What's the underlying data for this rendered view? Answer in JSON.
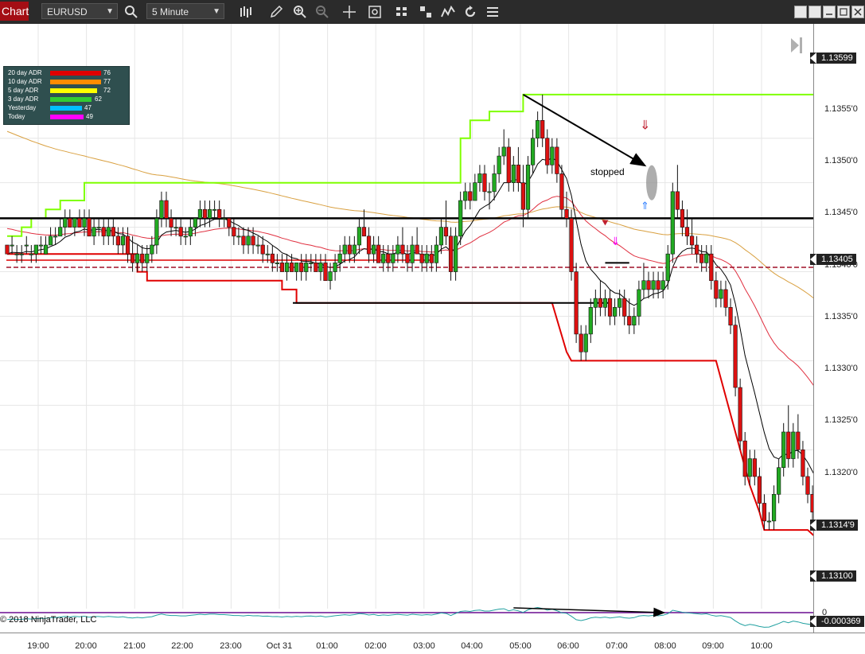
{
  "toolbar": {
    "chart_tab": "Chart",
    "instrument": "EURUSD",
    "interval": "5 Minute",
    "icons": [
      "search-icon",
      "bar-type-icon",
      "pencil-icon",
      "zoom-in-icon",
      "zoom-out-icon",
      "crosshair-icon",
      "data-box-icon",
      "properties-icon",
      "strategy-icon",
      "indicators-icon",
      "reload-icon",
      "menu-icon"
    ],
    "window_buttons": [
      "tile-1",
      "tile-2",
      "minimize",
      "restore",
      "close"
    ]
  },
  "legend": {
    "rows": [
      {
        "label": "20 day ADR",
        "color": "#e00000",
        "value": "76"
      },
      {
        "label": "10 day ADR",
        "color": "#ff8c00",
        "value": "77"
      },
      {
        "label": "5 day ADR",
        "color": "#ffff00",
        "value": "72"
      },
      {
        "label": "3 day ADR",
        "color": "#32cd32",
        "value": "62"
      },
      {
        "label": "Yesterday",
        "color": "#00bfff",
        "value": "47"
      },
      {
        "label": "Today",
        "color": "#ff00ff",
        "value": "49"
      }
    ]
  },
  "annotations": {
    "stopped": "stopped",
    "copyright": "© 2018 NinjaTrader, LLC"
  },
  "price_axis": {
    "labels": [
      "1.1355'0",
      "1.1350'0",
      "1.1345'0",
      "1.1340'0",
      "1.1335'0",
      "1.1330'0",
      "1.1325'0",
      "1.1320'0"
    ],
    "tags": {
      "high": "1.13599",
      "mid": "1.13405",
      "last": "1.1314'9",
      "low": "1.13100",
      "oscillator": "-0.000369"
    },
    "osc_zero": "0"
  },
  "time_axis": {
    "labels": [
      "19:00",
      "20:00",
      "21:00",
      "22:00",
      "23:00",
      "Oct 31",
      "01:00",
      "02:00",
      "03:00",
      "04:00",
      "05:00",
      "06:00",
      "07:00",
      "08:00",
      "09:00",
      "10:00"
    ]
  },
  "colors": {
    "up_candle": "#22aa22",
    "down_candle": "#dd1111",
    "upper_band": "#7fff00",
    "lower_band": "#e00000",
    "key_level": "#000000",
    "dashed_level": "#a01028",
    "ema_fast": "#000000",
    "ema_mid": "#e03040",
    "ema_slow": "#d9a040",
    "oscillator": "#20a0a0"
  },
  "chart_data": {
    "type": "candlestick",
    "instrument": "EURUSD",
    "interval": "5 Minute",
    "ylim": [
      1.1306,
      1.1364
    ],
    "key_levels": {
      "resistance": 1.1346,
      "dashed": 1.13405,
      "range_low": 1.13365
    },
    "x_ticks": [
      "19:00",
      "20:00",
      "21:00",
      "22:00",
      "23:00",
      "Oct 31",
      "01:00",
      "02:00",
      "03:00",
      "04:00",
      "05:00",
      "06:00",
      "07:00",
      "08:00",
      "09:00",
      "10:00"
    ],
    "upper_band": [
      [
        0,
        1.1344
      ],
      [
        3,
        1.1344
      ],
      [
        3,
        1.1345
      ],
      [
        5,
        1.1345
      ],
      [
        5,
        1.1346
      ],
      [
        8,
        1.1346
      ],
      [
        8,
        1.1347
      ],
      [
        11,
        1.1347
      ],
      [
        11,
        1.1348
      ],
      [
        16,
        1.1348
      ],
      [
        16,
        1.135
      ],
      [
        94,
        1.135
      ],
      [
        94,
        1.1355
      ],
      [
        96,
        1.1355
      ],
      [
        96,
        1.1357
      ],
      [
        100,
        1.1357
      ],
      [
        100,
        1.1358
      ],
      [
        107,
        1.1358
      ],
      [
        107,
        1.13599
      ],
      [
        169,
        1.13599
      ]
    ],
    "lower_band": [
      [
        0,
        1.1342
      ],
      [
        27,
        1.1342
      ],
      [
        27,
        1.134
      ],
      [
        29,
        1.134
      ],
      [
        29,
        1.1339
      ],
      [
        57,
        1.1339
      ],
      [
        57,
        1.1338
      ],
      [
        60,
        1.1338
      ],
      [
        60,
        1.13365
      ],
      [
        113,
        1.13365
      ],
      [
        116,
        1.1331
      ],
      [
        117,
        1.133
      ],
      [
        147,
        1.133
      ],
      [
        152,
        1.132
      ],
      [
        154,
        1.1316
      ],
      [
        156,
        1.1313
      ],
      [
        157,
        1.1311
      ],
      [
        166,
        1.1311
      ],
      [
        168,
        1.131
      ]
    ],
    "candles": [
      [
        1.1343,
        1.1343,
        1.1342,
        1.1342
      ],
      [
        1.1343,
        1.1344,
        1.1342,
        1.1343
      ],
      [
        1.1342,
        1.1343,
        1.1341,
        1.1342
      ],
      [
        1.1342,
        1.1343,
        1.1341,
        1.1342
      ],
      [
        1.1343,
        1.1344,
        1.1342,
        1.1343
      ],
      [
        1.1342,
        1.1343,
        1.1341,
        1.1342
      ],
      [
        1.1342,
        1.1343,
        1.1341,
        1.1343
      ],
      [
        1.1343,
        1.1344,
        1.1342,
        1.1343
      ],
      [
        1.1342,
        1.1344,
        1.1342,
        1.1343
      ],
      [
        1.1343,
        1.1345,
        1.1343,
        1.1344
      ],
      [
        1.1344,
        1.1345,
        1.1343,
        1.1344
      ],
      [
        1.1344,
        1.1346,
        1.1344,
        1.1345
      ],
      [
        1.1345,
        1.1347,
        1.1344,
        1.1346
      ],
      [
        1.1346,
        1.1347,
        1.1345,
        1.1345
      ],
      [
        1.1345,
        1.1346,
        1.1344,
        1.1346
      ],
      [
        1.1346,
        1.1347,
        1.1345,
        1.1345
      ],
      [
        1.1345,
        1.1347,
        1.1344,
        1.1346
      ],
      [
        1.1346,
        1.1347,
        1.1344,
        1.1344
      ],
      [
        1.1344,
        1.1346,
        1.1343,
        1.1345
      ],
      [
        1.1345,
        1.1346,
        1.1344,
        1.1345
      ],
      [
        1.1345,
        1.1346,
        1.1343,
        1.1344
      ],
      [
        1.1344,
        1.1346,
        1.1343,
        1.1345
      ],
      [
        1.1345,
        1.1346,
        1.1343,
        1.1344
      ],
      [
        1.1344,
        1.1345,
        1.1342,
        1.1343
      ],
      [
        1.1343,
        1.1345,
        1.1342,
        1.1344
      ],
      [
        1.1344,
        1.1345,
        1.1341,
        1.1342
      ],
      [
        1.1342,
        1.1344,
        1.134,
        1.1341
      ],
      [
        1.1341,
        1.1343,
        1.134,
        1.1342
      ],
      [
        1.1342,
        1.1343,
        1.134,
        1.1341
      ],
      [
        1.1341,
        1.1343,
        1.134,
        1.1342
      ],
      [
        1.1342,
        1.1344,
        1.1341,
        1.1343
      ],
      [
        1.1343,
        1.1347,
        1.1342,
        1.1346
      ],
      [
        1.1346,
        1.1349,
        1.1345,
        1.1348
      ],
      [
        1.1348,
        1.1349,
        1.1345,
        1.1346
      ],
      [
        1.1346,
        1.1347,
        1.1344,
        1.1345
      ],
      [
        1.1345,
        1.1346,
        1.1344,
        1.1345
      ],
      [
        1.1345,
        1.1346,
        1.1343,
        1.1344
      ],
      [
        1.1344,
        1.1345,
        1.1343,
        1.1344
      ],
      [
        1.1344,
        1.1346,
        1.1343,
        1.1345
      ],
      [
        1.1345,
        1.1346,
        1.1344,
        1.1346
      ],
      [
        1.1346,
        1.1348,
        1.1345,
        1.1347
      ],
      [
        1.1347,
        1.1348,
        1.1345,
        1.1346
      ],
      [
        1.1346,
        1.1348,
        1.1345,
        1.1347
      ],
      [
        1.1347,
        1.1348,
        1.1346,
        1.1347
      ],
      [
        1.1347,
        1.1348,
        1.1345,
        1.1346
      ],
      [
        1.1346,
        1.1347,
        1.1345,
        1.1346
      ],
      [
        1.1346,
        1.1346,
        1.1344,
        1.1345
      ],
      [
        1.1345,
        1.1346,
        1.1343,
        1.1344
      ],
      [
        1.1344,
        1.1345,
        1.1343,
        1.1344
      ],
      [
        1.1344,
        1.1345,
        1.1342,
        1.1343
      ],
      [
        1.1343,
        1.1345,
        1.1342,
        1.1344
      ],
      [
        1.1344,
        1.1345,
        1.1342,
        1.1343
      ],
      [
        1.1343,
        1.1344,
        1.1342,
        1.1343
      ],
      [
        1.1343,
        1.1344,
        1.1341,
        1.1342
      ],
      [
        1.1342,
        1.1343,
        1.1341,
        1.1342
      ],
      [
        1.1342,
        1.1343,
        1.134,
        1.1341
      ],
      [
        1.1341,
        1.1342,
        1.134,
        1.1341
      ],
      [
        1.1341,
        1.1342,
        1.134,
        1.134
      ],
      [
        1.134,
        1.1342,
        1.1339,
        1.1341
      ],
      [
        1.1341,
        1.1342,
        1.134,
        1.134
      ],
      [
        1.134,
        1.1341,
        1.1339,
        1.1341
      ],
      [
        1.1341,
        1.1342,
        1.1339,
        1.134
      ],
      [
        1.134,
        1.1342,
        1.1339,
        1.1341
      ],
      [
        1.1341,
        1.1342,
        1.134,
        1.1341
      ],
      [
        1.1341,
        1.1342,
        1.134,
        1.134
      ],
      [
        1.134,
        1.1342,
        1.1339,
        1.1341
      ],
      [
        1.1341,
        1.1342,
        1.1339,
        1.1339
      ],
      [
        1.1339,
        1.1341,
        1.1338,
        1.134
      ],
      [
        1.134,
        1.1342,
        1.1339,
        1.1341
      ],
      [
        1.1341,
        1.1343,
        1.134,
        1.1342
      ],
      [
        1.1342,
        1.1344,
        1.1341,
        1.1343
      ],
      [
        1.1343,
        1.1344,
        1.1341,
        1.1342
      ],
      [
        1.1342,
        1.1344,
        1.1341,
        1.1343
      ],
      [
        1.1343,
        1.1346,
        1.1342,
        1.1345
      ],
      [
        1.1345,
        1.1347,
        1.1344,
        1.1344
      ],
      [
        1.1344,
        1.1345,
        1.1341,
        1.1342
      ],
      [
        1.1342,
        1.1344,
        1.1341,
        1.1343
      ],
      [
        1.1343,
        1.1344,
        1.1341,
        1.1341
      ],
      [
        1.1341,
        1.1343,
        1.134,
        1.1342
      ],
      [
        1.1342,
        1.1343,
        1.134,
        1.1341
      ],
      [
        1.1341,
        1.1343,
        1.134,
        1.1342
      ],
      [
        1.1342,
        1.1344,
        1.1341,
        1.1343
      ],
      [
        1.1343,
        1.1345,
        1.1341,
        1.1342
      ],
      [
        1.1342,
        1.1343,
        1.134,
        1.1341
      ],
      [
        1.1341,
        1.1344,
        1.134,
        1.1343
      ],
      [
        1.1343,
        1.1345,
        1.1342,
        1.1342
      ],
      [
        1.1342,
        1.1343,
        1.134,
        1.1341
      ],
      [
        1.1341,
        1.1343,
        1.134,
        1.1342
      ],
      [
        1.1342,
        1.1343,
        1.134,
        1.1341
      ],
      [
        1.1341,
        1.1344,
        1.134,
        1.1343
      ],
      [
        1.1343,
        1.1346,
        1.1342,
        1.1345
      ],
      [
        1.1345,
        1.1348,
        1.1343,
        1.1344
      ],
      [
        1.1344,
        1.1345,
        1.1339,
        1.134
      ],
      [
        1.134,
        1.1345,
        1.1339,
        1.1344
      ],
      [
        1.1344,
        1.1349,
        1.1343,
        1.1348
      ],
      [
        1.1348,
        1.135,
        1.1347,
        1.1349
      ],
      [
        1.1349,
        1.135,
        1.1347,
        1.1348
      ],
      [
        1.1348,
        1.1351,
        1.1348,
        1.135
      ],
      [
        1.135,
        1.1352,
        1.1349,
        1.1351
      ],
      [
        1.1351,
        1.1352,
        1.1348,
        1.1349
      ],
      [
        1.1349,
        1.135,
        1.1347,
        1.1349
      ],
      [
        1.1349,
        1.1352,
        1.1348,
        1.1351
      ],
      [
        1.1351,
        1.1354,
        1.135,
        1.1353
      ],
      [
        1.1353,
        1.1356,
        1.1352,
        1.1354
      ],
      [
        1.1354,
        1.1355,
        1.1349,
        1.135
      ],
      [
        1.135,
        1.1353,
        1.1349,
        1.1352
      ],
      [
        1.1352,
        1.1354,
        1.1349,
        1.135
      ],
      [
        1.135,
        1.1352,
        1.1345,
        1.1347
      ],
      [
        1.1347,
        1.1353,
        1.1346,
        1.1352
      ],
      [
        1.1352,
        1.1356,
        1.1351,
        1.1355
      ],
      [
        1.1355,
        1.1358,
        1.1354,
        1.1357
      ],
      [
        1.1357,
        1.13599,
        1.1354,
        1.1355
      ],
      [
        1.1355,
        1.1356,
        1.1351,
        1.1352
      ],
      [
        1.1352,
        1.1355,
        1.1351,
        1.1354
      ],
      [
        1.1354,
        1.1355,
        1.135,
        1.1351
      ],
      [
        1.1351,
        1.1352,
        1.1346,
        1.1347
      ],
      [
        1.1347,
        1.1349,
        1.1345,
        1.1346
      ],
      [
        1.1346,
        1.1347,
        1.1339,
        1.134
      ],
      [
        1.134,
        1.1341,
        1.1332,
        1.1333
      ],
      [
        1.1333,
        1.1334,
        1.133,
        1.1331
      ],
      [
        1.1331,
        1.1334,
        1.133,
        1.1333
      ],
      [
        1.1333,
        1.1337,
        1.1332,
        1.1336
      ],
      [
        1.1336,
        1.1338,
        1.1334,
        1.1337
      ],
      [
        1.1337,
        1.1339,
        1.1335,
        1.1336
      ],
      [
        1.1336,
        1.1338,
        1.1335,
        1.1337
      ],
      [
        1.1337,
        1.1338,
        1.1334,
        1.1335
      ],
      [
        1.1335,
        1.1337,
        1.1334,
        1.1336
      ],
      [
        1.1336,
        1.1338,
        1.1335,
        1.1337
      ],
      [
        1.1337,
        1.1338,
        1.1334,
        1.1335
      ],
      [
        1.1335,
        1.1337,
        1.1333,
        1.1334
      ],
      [
        1.1334,
        1.1336,
        1.1333,
        1.1335
      ],
      [
        1.1335,
        1.1339,
        1.1334,
        1.1338
      ],
      [
        1.1338,
        1.1341,
        1.1337,
        1.1339
      ],
      [
        1.1339,
        1.134,
        1.1337,
        1.1338
      ],
      [
        1.1338,
        1.134,
        1.1337,
        1.1339
      ],
      [
        1.1339,
        1.134,
        1.1337,
        1.1338
      ],
      [
        1.1338,
        1.134,
        1.1337,
        1.1339
      ],
      [
        1.1339,
        1.1343,
        1.1338,
        1.1342
      ],
      [
        1.1342,
        1.135,
        1.1341,
        1.1349
      ],
      [
        1.1349,
        1.1352,
        1.1346,
        1.1347
      ],
      [
        1.1347,
        1.1348,
        1.1344,
        1.1345
      ],
      [
        1.1345,
        1.1347,
        1.1343,
        1.1344
      ],
      [
        1.1344,
        1.1346,
        1.1342,
        1.1343
      ],
      [
        1.1343,
        1.1344,
        1.1341,
        1.1342
      ],
      [
        1.1342,
        1.1343,
        1.134,
        1.1341
      ],
      [
        1.1341,
        1.1343,
        1.134,
        1.1342
      ],
      [
        1.1342,
        1.1343,
        1.1338,
        1.1339
      ],
      [
        1.1339,
        1.134,
        1.1336,
        1.1337
      ],
      [
        1.1337,
        1.1339,
        1.1336,
        1.1338
      ],
      [
        1.1338,
        1.1339,
        1.1335,
        1.1336
      ],
      [
        1.1336,
        1.1337,
        1.1333,
        1.1334
      ],
      [
        1.1334,
        1.1335,
        1.1326,
        1.1327
      ],
      [
        1.1327,
        1.1328,
        1.132,
        1.1321
      ],
      [
        1.1321,
        1.1322,
        1.1316,
        1.1317
      ],
      [
        1.1317,
        1.132,
        1.1316,
        1.1319
      ],
      [
        1.1319,
        1.132,
        1.1316,
        1.1317
      ],
      [
        1.1317,
        1.1318,
        1.1313,
        1.1314
      ],
      [
        1.1314,
        1.1315,
        1.1311,
        1.1312
      ],
      [
        1.1312,
        1.1313,
        1.1311,
        1.1312
      ],
      [
        1.1312,
        1.1316,
        1.1311,
        1.1315
      ],
      [
        1.1315,
        1.1319,
        1.1314,
        1.1318
      ],
      [
        1.1318,
        1.1323,
        1.1317,
        1.1322
      ],
      [
        1.1322,
        1.1325,
        1.1318,
        1.1319
      ],
      [
        1.1319,
        1.1323,
        1.1318,
        1.1322
      ],
      [
        1.1322,
        1.1324,
        1.1319,
        1.132
      ],
      [
        1.132,
        1.1321,
        1.1316,
        1.1317
      ],
      [
        1.1317,
        1.1318,
        1.1314,
        1.1315
      ],
      [
        1.1315,
        1.1316,
        1.1312,
        1.1313
      ],
      [
        1.1313,
        1.1314,
        1.1311,
        1.1312
      ],
      [
        1.1312,
        1.1316,
        1.1311,
        1.1314
      ],
      [
        1.1314,
        1.1316,
        1.1313,
        1.13149
      ]
    ]
  }
}
